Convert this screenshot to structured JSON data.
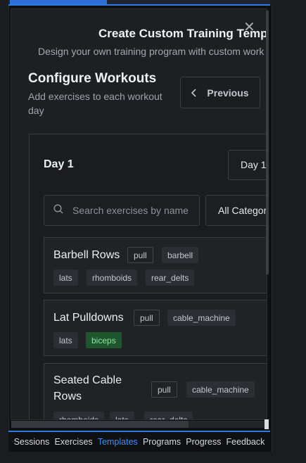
{
  "modal": {
    "title": "Create Custom Training Temp",
    "subtitle": "Design your own training program with custom work",
    "close_icon": "close-icon"
  },
  "section": {
    "title": "Configure Workouts",
    "description": "Add exercises to each workout day",
    "previous_label": "Previous"
  },
  "day": {
    "label": "Day 1",
    "selected": "Day 1"
  },
  "filters": {
    "search_placeholder": "Search exercises by name",
    "category_selected": "All Categories"
  },
  "exercises": [
    {
      "name": "Barbell Rows",
      "type": "pull",
      "equipment": "barbell",
      "muscles": [
        "lats",
        "rhomboids",
        "rear_delts"
      ]
    },
    {
      "name": "Lat Pulldowns",
      "type": "pull",
      "equipment": "cable_machine",
      "muscles": [
        "lats",
        "biceps"
      ]
    },
    {
      "name": "Seated Cable Rows",
      "type": "pull",
      "equipment": "cable_machine",
      "muscles": [
        "rhomboids",
        "lats",
        "rear_delts"
      ]
    }
  ],
  "nav": {
    "items": [
      "Sessions",
      "Exercises",
      "Templates",
      "Programs",
      "Progress",
      "Feedback"
    ],
    "active": "Templates"
  },
  "colors": {
    "accent": "#2f7be3",
    "green_tag": "#20562d",
    "background": "#1d1f23"
  }
}
